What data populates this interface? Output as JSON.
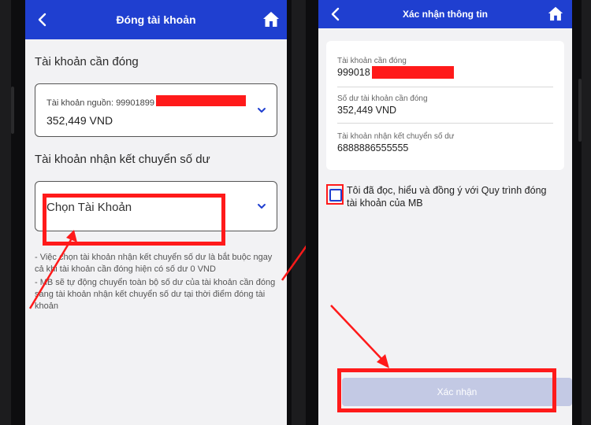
{
  "left_screen": {
    "header": {
      "title": "Đóng tài khoản",
      "back_icon": "chevron-left-icon",
      "home_icon": "home-icon"
    },
    "close_section": {
      "title": "Tài khoản cần đóng",
      "source_label": "Tài khoản nguồn: 99901899",
      "balance": "352,449 VND"
    },
    "receive_section": {
      "title": "Tài khoản nhận kết chuyển số dư",
      "placeholder": "Chọn Tài Khoản"
    },
    "notes": [
      "- Việc chọn tài khoản nhận kết chuyển số dư là bắt buộc ngay cả khi tài khoản cần đóng hiện có số dư 0 VND",
      "- MB sẽ tự động chuyển toàn bộ số dư của tài khoản cần đóng sang tài khoản nhận kết chuyển số dư tại thời điểm đóng tài khoản"
    ]
  },
  "right_screen": {
    "header": {
      "title": "Xác nhận thông tin",
      "back_icon": "chevron-left-icon",
      "home_icon": "home-icon"
    },
    "fields": [
      {
        "label": "Tài khoản cần đóng",
        "value": "999018"
      },
      {
        "label": "Số dư tài khoản cần đóng",
        "value": "352,449 VND"
      },
      {
        "label": "Tài khoản nhận kết chuyển số dư",
        "value": "6888886555555"
      }
    ],
    "consent_text": "Tôi đã đọc, hiểu và đồng ý với Quy trình đóng tài khoản của MB",
    "confirm_label": "Xác nhận"
  },
  "colors": {
    "header_blue": "#1f3fd0",
    "annotation_red": "#ff1a1a",
    "disabled_button": "#c3c9e4"
  }
}
